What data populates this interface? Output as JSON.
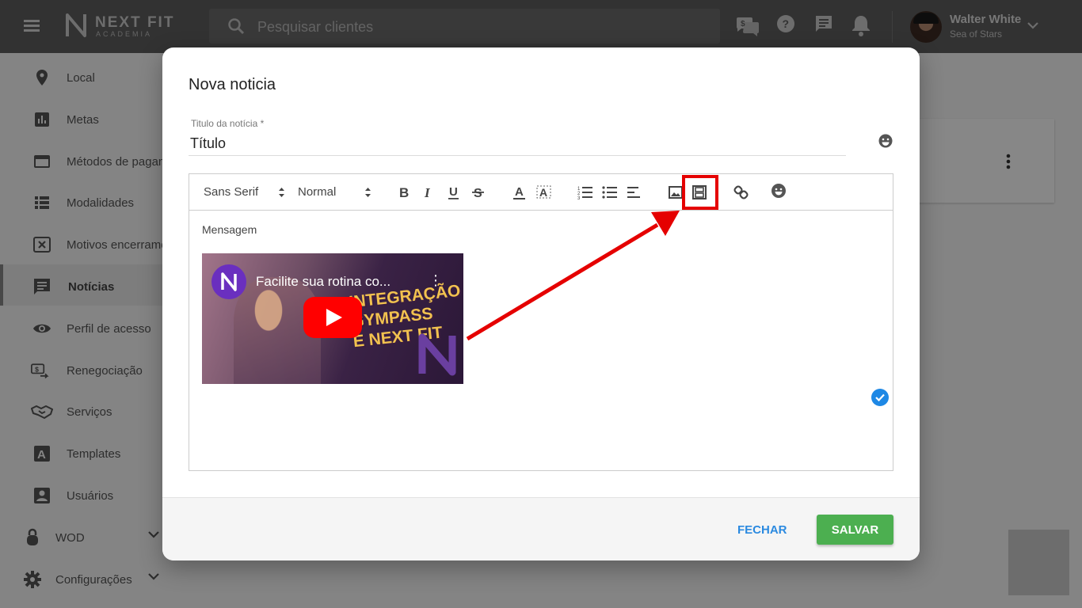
{
  "app": {
    "brand_name": "NEXT FIT",
    "brand_sub": "ACADEMIA",
    "search_placeholder": "Pesquisar clientes",
    "user_name": "Walter White",
    "user_org": "Sea of Stars",
    "top_icons": [
      "money-chat-icon",
      "help-icon",
      "chat-icon",
      "bell-icon"
    ]
  },
  "sidebar": {
    "items": [
      {
        "label": "Local",
        "icon": "location-pin-icon"
      },
      {
        "label": "Metas",
        "icon": "bar-chart-icon"
      },
      {
        "label": "Métodos de pagamento",
        "icon": "credit-card-icon"
      },
      {
        "label": "Modalidades",
        "icon": "list-icon"
      },
      {
        "label": "Motivos encerramento",
        "icon": "x-box-icon"
      },
      {
        "label": "Notícias",
        "icon": "message-icon",
        "active": true
      },
      {
        "label": "Perfil de acesso",
        "icon": "eye-icon"
      },
      {
        "label": "Renegociação",
        "icon": "money-swap-icon"
      },
      {
        "label": "Serviços",
        "icon": "handshake-icon"
      },
      {
        "label": "Templates",
        "icon": "letter-a-icon"
      },
      {
        "label": "Usuários",
        "icon": "user-box-icon"
      },
      {
        "label": "WOD",
        "icon": "kettlebell-icon"
      },
      {
        "label": "Configurações",
        "icon": "gear-icon"
      }
    ]
  },
  "dialog": {
    "title": "Nova noticia",
    "title_field_label": "Titulo da notícia *",
    "title_field_value": "Título",
    "toolbar": {
      "font": "Sans Serif",
      "size": "Normal"
    },
    "content_text": "Mensagem",
    "video": {
      "title": "Facilite sua rotina co...",
      "promo_line1": "INTEGRAÇÃO",
      "promo_line2": "GYMPASS",
      "promo_line3": "E NEXT FIT"
    },
    "close_label": "FECHAR",
    "save_label": "SALVAR"
  },
  "colors": {
    "highlight": "#e50000",
    "save": "#4caf50",
    "close": "#2b8ae0",
    "topbar": "#5f5f5f"
  }
}
